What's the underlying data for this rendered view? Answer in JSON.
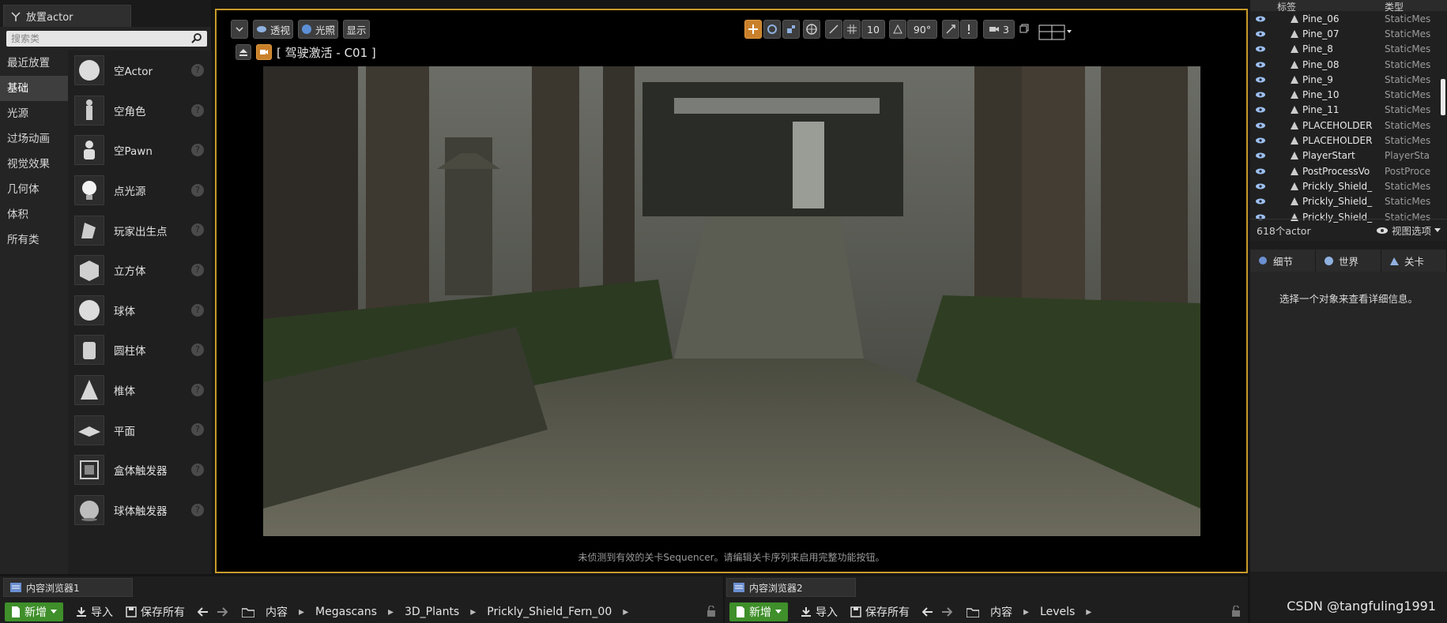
{
  "place_actor": {
    "tab_title": "放置actor",
    "search_placeholder": "搜索类",
    "categories": [
      "最近放置",
      "基础",
      "光源",
      "过场动画",
      "视觉效果",
      "几何体",
      "体积",
      "所有类"
    ],
    "active_category_index": 1,
    "items": [
      {
        "label": "空Actor",
        "icon": "sphere-icon"
      },
      {
        "label": "空角色",
        "icon": "mannequin-icon"
      },
      {
        "label": "空Pawn",
        "icon": "pawn-icon"
      },
      {
        "label": "点光源",
        "icon": "lightbulb-icon"
      },
      {
        "label": "玩家出生点",
        "icon": "player-start-icon"
      },
      {
        "label": "立方体",
        "icon": "cube-icon"
      },
      {
        "label": "球体",
        "icon": "sphere-icon"
      },
      {
        "label": "圆柱体",
        "icon": "cylinder-icon"
      },
      {
        "label": "椎体",
        "icon": "cone-icon"
      },
      {
        "label": "平面",
        "icon": "plane-icon"
      },
      {
        "label": "盒体触发器",
        "icon": "box-trigger-icon"
      },
      {
        "label": "球体触发器",
        "icon": "sphere-trigger-icon"
      }
    ]
  },
  "viewport": {
    "perspective_label": "透视",
    "lit_label": "光照",
    "show_label": "显示",
    "camera_title": "[ 驾驶激活 - C01 ]",
    "grid_snap_value": "10",
    "rotation_snap_value": "90°",
    "camera_speed_value": "3",
    "status_message": "未侦测到有效的关卡Sequencer。请编辑关卡序列来启用完整功能按钮。",
    "accent_color": "#c99a2a"
  },
  "outliner": {
    "col_label": "标签",
    "col_type": "类型",
    "rows": [
      {
        "name": "Pine_06",
        "type": "StaticMes"
      },
      {
        "name": "Pine_07",
        "type": "StaticMes"
      },
      {
        "name": "Pine_8",
        "type": "StaticMes"
      },
      {
        "name": "Pine_08",
        "type": "StaticMes"
      },
      {
        "name": "Pine_9",
        "type": "StaticMes"
      },
      {
        "name": "Pine_10",
        "type": "StaticMes"
      },
      {
        "name": "Pine_11",
        "type": "StaticMes"
      },
      {
        "name": "PLACEHOLDER",
        "type": "StaticMes"
      },
      {
        "name": "PLACEHOLDER",
        "type": "StaticMes"
      },
      {
        "name": "PlayerStart",
        "type": "PlayerSta"
      },
      {
        "name": "PostProcessVo",
        "type": "PostProce"
      },
      {
        "name": "Prickly_Shield_",
        "type": "StaticMes"
      },
      {
        "name": "Prickly_Shield_",
        "type": "StaticMes"
      },
      {
        "name": "Prickly_Shield_",
        "type": "StaticMes"
      }
    ],
    "actor_count": "618个actor",
    "view_options": "视图选项"
  },
  "details": {
    "tabs": [
      "细节",
      "世界",
      "关卡"
    ],
    "empty_message": "选择一个对象来查看详细信息。"
  },
  "content_browser_1": {
    "tab_title": "内容浏览器1",
    "new_label": "新增",
    "import_label": "导入",
    "save_all_label": "保存所有",
    "path": [
      "内容",
      "Megascans",
      "3D_Plants",
      "Prickly_Shield_Fern_00"
    ]
  },
  "content_browser_2": {
    "tab_title": "内容浏览器2",
    "new_label": "新增",
    "import_label": "导入",
    "save_all_label": "保存所有",
    "path": [
      "内容",
      "Levels"
    ]
  },
  "watermark": "CSDN @tangfuling1991"
}
